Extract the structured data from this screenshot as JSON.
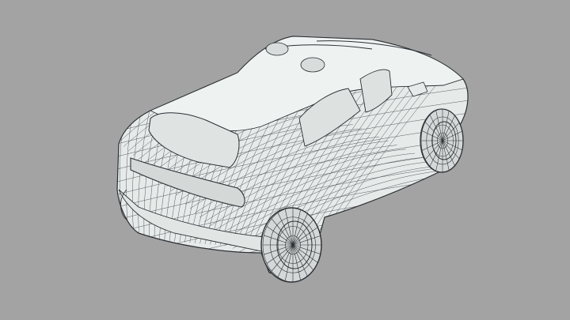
{
  "viewport": {
    "background_color": "#a3a3a3"
  },
  "model": {
    "subject": "car-wireframe",
    "view": "rear-three-quarter",
    "shading": "wireframe-on-shaded",
    "surface_color": "#e6ebea",
    "wire_color": "#2b2f33",
    "tire_color": "#d4d8d8",
    "parts": [
      {
        "name": "car-body-mesh"
      },
      {
        "name": "roof-mesh"
      },
      {
        "name": "rear-window"
      },
      {
        "name": "side-windows"
      },
      {
        "name": "rear-left-wheel"
      },
      {
        "name": "rear-right-wheel"
      },
      {
        "name": "front-right-wheel"
      },
      {
        "name": "taillight-bar"
      },
      {
        "name": "rear-bumper"
      },
      {
        "name": "roof-rails"
      }
    ]
  }
}
